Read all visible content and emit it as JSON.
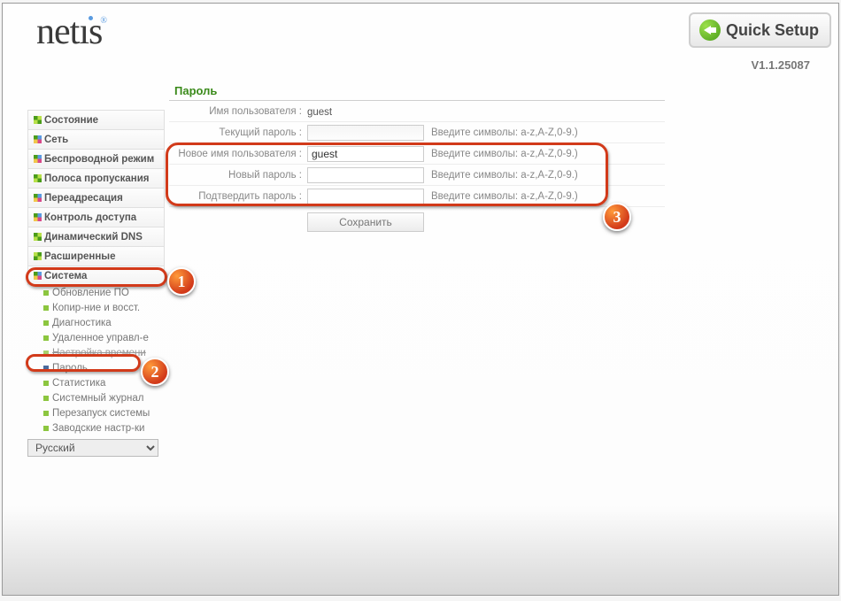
{
  "brand": "netis",
  "quick_setup_label": "Quick Setup",
  "version": "V1.1.25087",
  "language_selected": "Русский",
  "nav": {
    "status": "Состояние",
    "network": "Сеть",
    "wireless": "Беспроводной режим",
    "bandwidth": "Полоса пропускания",
    "forwarding": "Переадресация",
    "access": "Контроль доступа",
    "ddns": "Динамический DNS",
    "advanced": "Расширенные",
    "system": "Система"
  },
  "subnav": {
    "firmware": "Обновление ПО",
    "backup": "Копир-ние и восст.",
    "diag": "Диагностика",
    "remote": "Удаленное управл-е",
    "time": "Настройка времени",
    "password": "Пароль",
    "stats": "Статистика",
    "syslog": "Системный журнал",
    "reboot": "Перезапуск системы",
    "factory": "Заводские настр-ки"
  },
  "panel": {
    "title": "Пароль",
    "rows": {
      "username": {
        "label": "Имя пользователя :",
        "value": "guest"
      },
      "cur_pw": {
        "label": "Текущий пароль :",
        "value": "",
        "hint": "Введите символы: a-z,A-Z,0-9.)"
      },
      "new_user": {
        "label": "Новое имя пользователя :",
        "value": "guest",
        "hint": "Введите символы: a-z,A-Z,0-9.)"
      },
      "new_pw": {
        "label": "Новый пароль :",
        "value": "",
        "hint": "Введите символы: a-z,A-Z,0-9.)"
      },
      "conf_pw": {
        "label": "Подтвердить пароль :",
        "value": "",
        "hint": "Введите символы: a-z,A-Z,0-9.)"
      }
    },
    "save": "Сохранить"
  },
  "markers": {
    "one": "1",
    "two": "2",
    "three": "3"
  }
}
